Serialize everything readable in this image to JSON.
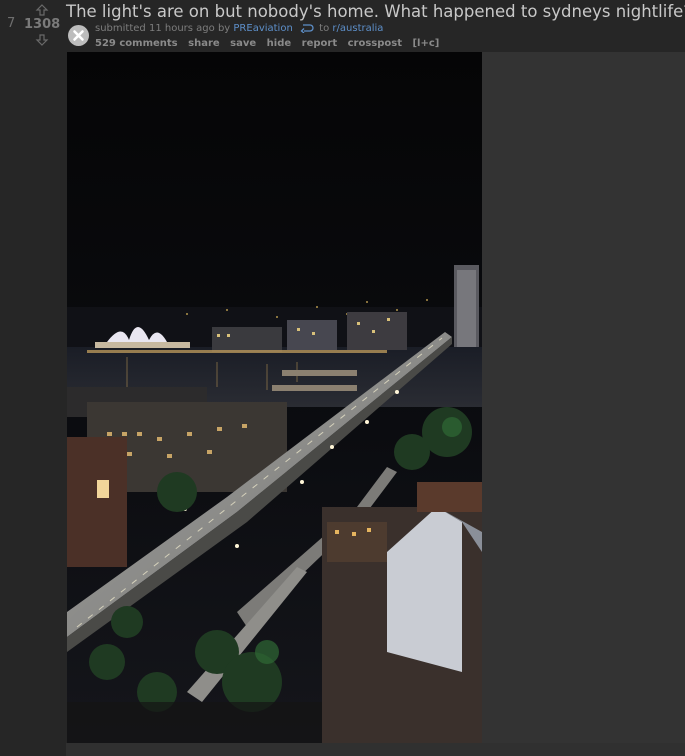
{
  "post": {
    "rank": "7",
    "score": "1308",
    "title": "The light's are on but nobody's home. What happened to sydneys nightlife?",
    "tagline": {
      "submitted": "submitted",
      "time": "11 hours ago",
      "by": "by",
      "author": "PREaviation",
      "to": "to",
      "subreddit": "r/australia"
    },
    "buttons": {
      "comments": "529 comments",
      "share": "share",
      "save": "save",
      "hide": "hide",
      "report": "report",
      "crosspost": "crosspost",
      "shortcut": "[l+c]"
    }
  },
  "icons": {
    "upvote": "upvote-arrow-icon",
    "downvote": "downvote-arrow-icon",
    "close": "close-icon",
    "crosspost": "crosspost-icon"
  },
  "colors": {
    "background": "#262626",
    "link": "#5d8fc9",
    "title": "#c8c8c8"
  }
}
